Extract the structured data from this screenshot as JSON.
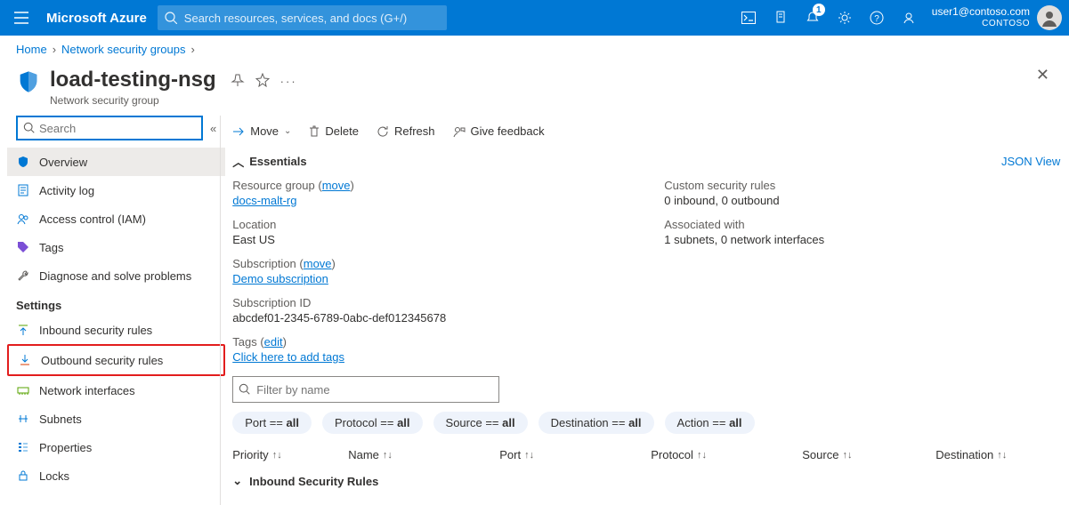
{
  "header": {
    "brand": "Microsoft Azure",
    "search_placeholder": "Search resources, services, and docs (G+/)",
    "notifications_badge": "1",
    "account_email": "user1@contoso.com",
    "account_tenant": "CONTOSO"
  },
  "breadcrumbs": {
    "home": "Home",
    "nsg": "Network security groups"
  },
  "page": {
    "title": "load-testing-nsg",
    "subtype": "Network security group"
  },
  "cmdbar": {
    "move": "Move",
    "delete": "Delete",
    "refresh": "Refresh",
    "feedback": "Give feedback"
  },
  "essentials": {
    "label": "Essentials",
    "json_view": "JSON View",
    "rg_label": "Resource group",
    "rg_move": "move",
    "rg_value": "docs-malt-rg",
    "loc_label": "Location",
    "loc_value": "East US",
    "sub_label": "Subscription",
    "sub_move": "move",
    "sub_value": "Demo subscription",
    "subid_label": "Subscription ID",
    "subid_value": "abcdef01-2345-6789-0abc-def012345678",
    "tags_label": "Tags",
    "tags_edit": "edit",
    "tags_value": "Click here to add tags",
    "cust_label": "Custom security rules",
    "cust_value": "0 inbound, 0 outbound",
    "assoc_label": "Associated with",
    "assoc_value": "1 subnets, 0 network interfaces"
  },
  "sidebar": {
    "search_placeholder": "Search",
    "items": {
      "overview": "Overview",
      "activity": "Activity log",
      "iam": "Access control (IAM)",
      "tags": "Tags",
      "diagnose": "Diagnose and solve problems",
      "settings": "Settings",
      "inbound": "Inbound security rules",
      "outbound": "Outbound security rules",
      "nics": "Network interfaces",
      "subnets": "Subnets",
      "properties": "Properties",
      "locks": "Locks"
    }
  },
  "rules": {
    "filter_placeholder": "Filter by name",
    "pills": {
      "port_k": "Port == ",
      "port_v": "all",
      "proto_k": "Protocol == ",
      "proto_v": "all",
      "src_k": "Source == ",
      "src_v": "all",
      "dst_k": "Destination == ",
      "dst_v": "all",
      "act_k": "Action == ",
      "act_v": "all"
    },
    "cols": {
      "priority": "Priority",
      "name": "Name",
      "port": "Port",
      "protocol": "Protocol",
      "source": "Source",
      "destination": "Destination"
    },
    "group_inbound": "Inbound Security Rules"
  }
}
